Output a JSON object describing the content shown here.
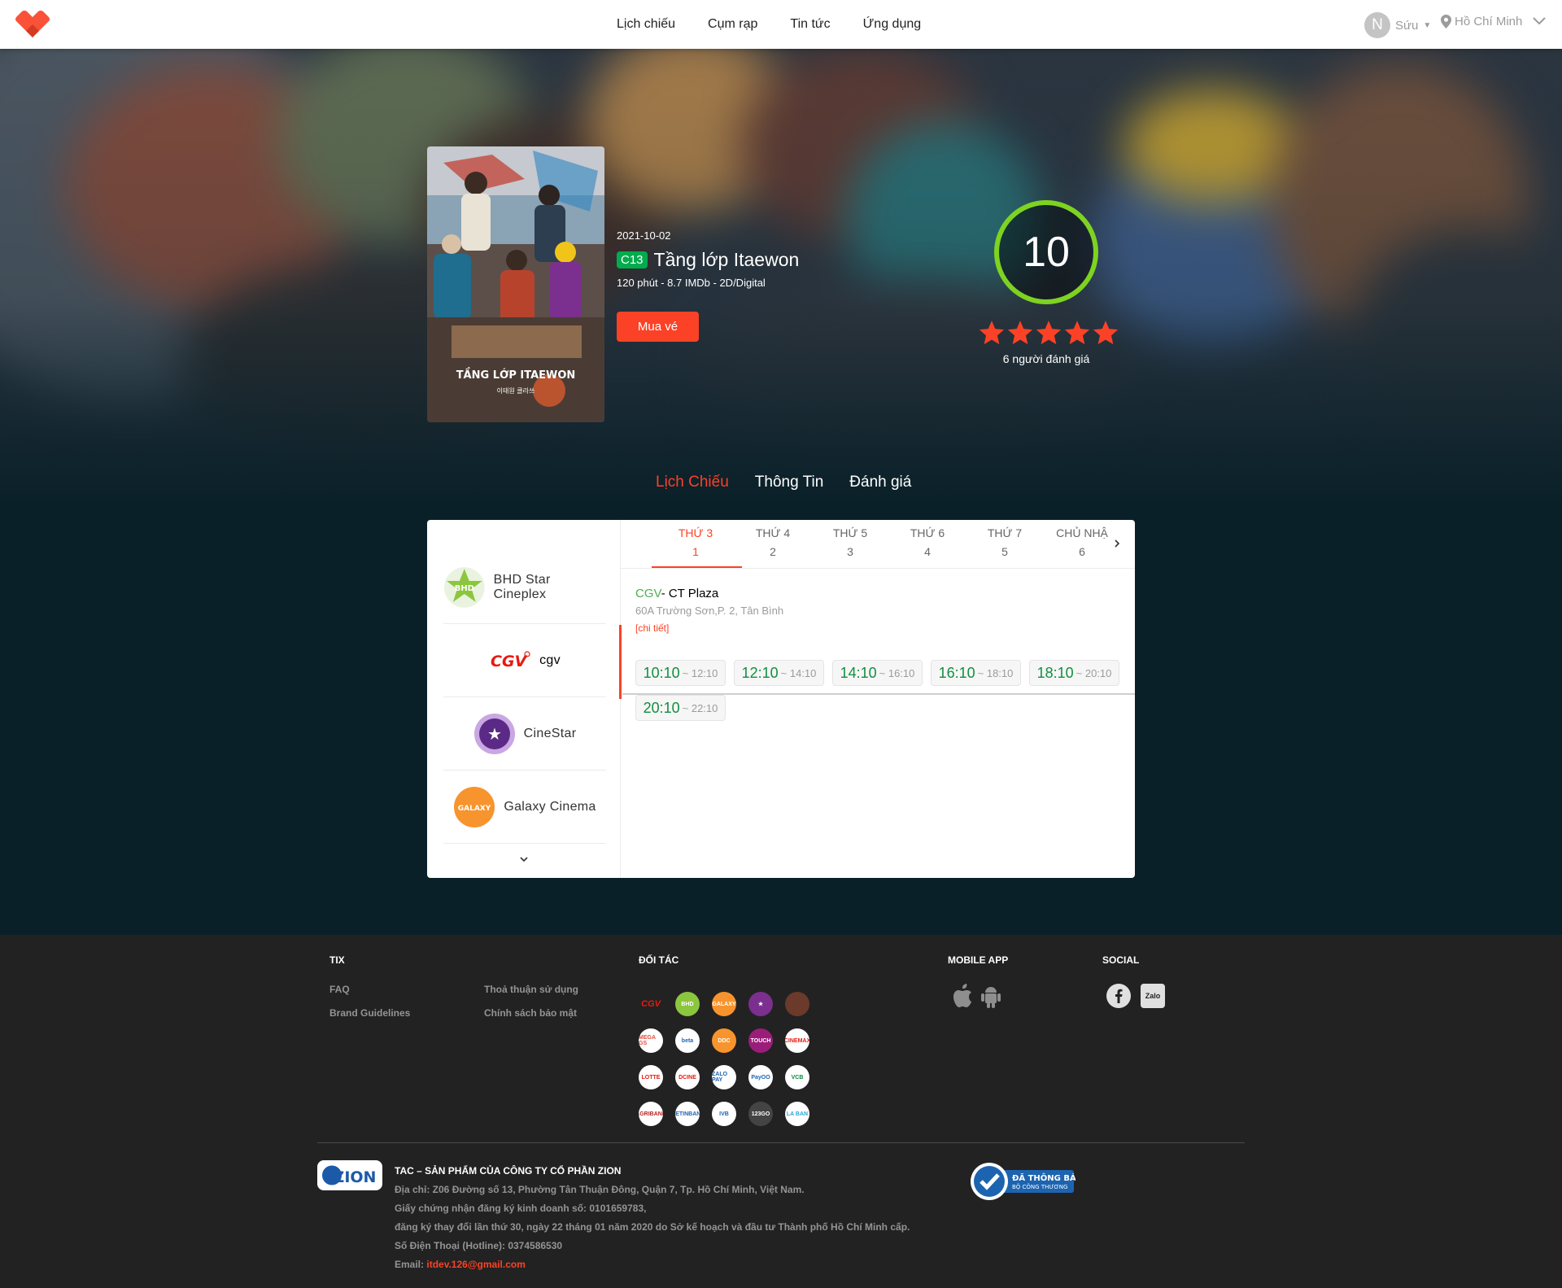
{
  "header": {
    "nav": [
      "Lịch chiếu",
      "Cụm rạp",
      "Tin tức",
      "Ứng dụng"
    ],
    "user_initial": "N",
    "user_name": "Sứu",
    "location": "Hồ Chí Minh"
  },
  "film": {
    "poster_caption": "TẦNG LỚP ITAEWON",
    "poster_korean": "이태원 클라쓰",
    "date": "2021-10-02",
    "age_rating": "C13",
    "title": "Tầng lớp Itaewon",
    "meta": "120 phút - 8.7 IMDb - 2D/Digital",
    "buy_label": "Mua vé",
    "score": "10",
    "stars": 5,
    "review_count": "6 người đánh giá"
  },
  "tabs": [
    "Lịch Chiếu",
    "Thông Tin",
    "Đánh giá"
  ],
  "cinemas": [
    {
      "name": "BHD Star Cineplex",
      "logo_text": "BHD"
    },
    {
      "name": "cgv",
      "logo_text": "CGV"
    },
    {
      "name": "CineStar",
      "logo_text": "★"
    },
    {
      "name": "Galaxy Cinema",
      "logo_text": "GALAXY"
    }
  ],
  "days": [
    {
      "label": "THỨ 3",
      "num": "1"
    },
    {
      "label": "THỨ 4",
      "num": "2"
    },
    {
      "label": "THỨ 5",
      "num": "3"
    },
    {
      "label": "THỨ 6",
      "num": "4"
    },
    {
      "label": "THỨ 7",
      "num": "5"
    },
    {
      "label": "CHỦ NHẬ",
      "num": "6"
    }
  ],
  "theater": {
    "brand": "CGV",
    "name": "- CT Plaza",
    "address": "60A Trường Sơn,P. 2, Tân Bình",
    "detail_label": "[chi tiết]",
    "showtimes": [
      {
        "start": "10:10",
        "end": "~ 12:10"
      },
      {
        "start": "12:10",
        "end": "~ 14:10"
      },
      {
        "start": "14:10",
        "end": "~ 16:10"
      },
      {
        "start": "16:10",
        "end": "~ 18:10"
      },
      {
        "start": "18:10",
        "end": "~ 20:10"
      },
      {
        "start": "20:10",
        "end": "~ 22:10"
      }
    ]
  },
  "footer": {
    "tix_heading": "TIX",
    "links": [
      "FAQ",
      "Thoả thuận sử dụng",
      "Brand Guidelines",
      "Chính sách bảo mật"
    ],
    "partners_heading": "ĐỐI TÁC",
    "mobile_heading": "MOBILE APP",
    "social_heading": "SOCIAL",
    "partner_labels": [
      "CGV",
      "BHD",
      "GALAXY",
      "★",
      "",
      "MEGA GS",
      "beta",
      "DDC",
      "TOUCH",
      "CINEMAX",
      "LOTTE",
      "DCINE",
      "ZALO PAY",
      "PayOO",
      "VCB",
      "AGRIBANK",
      "VIETINBANK",
      "IVB",
      "123GO",
      "LA BAN"
    ],
    "zion_logo_text": "ZION",
    "company_title": "TAC – SẢN PHẨM CỦA CÔNG TY CỔ PHẦN ZION",
    "company_lines": [
      "Địa chỉ: Z06 Đường số 13, Phường Tân Thuận Đông, Quận 7, Tp. Hồ Chí Minh, Việt Nam.",
      "Giấy chứng nhận đăng ký kinh doanh số: 0101659783,",
      "đăng ký thay đổi lần thứ 30, ngày 22 tháng 01 năm 2020 do Sở kế hoạch và đầu tư Thành phố Hồ Chí Minh cấp.",
      "Số Điện Thoại (Hotline): 0374586530"
    ],
    "email_label": "Email: ",
    "email": "itdev.126@gmail.com",
    "verified_text": "ĐÃ THÔNG BÁO",
    "verified_sub": "BỘ CÔNG THƯƠNG",
    "zalo_label": "Zalo"
  }
}
